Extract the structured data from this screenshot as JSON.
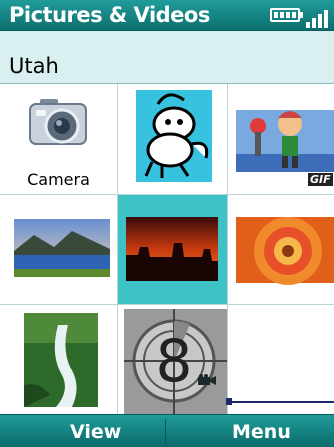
{
  "title_bar": {
    "title": "Pictures & Videos",
    "battery_icon": "battery-icon",
    "signal_icon": "signal-icon"
  },
  "folder": {
    "name": "Utah"
  },
  "items": [
    {
      "label": "Camera",
      "icon": "camera-icon"
    },
    {
      "label": "",
      "icon": "cartoon-character"
    },
    {
      "label": "",
      "icon": "cartoon-animation",
      "badge": "GIF"
    },
    {
      "label": "",
      "icon": "lake-landscape"
    },
    {
      "label": "",
      "icon": "desert-sunset",
      "selected": true
    },
    {
      "label": "",
      "icon": "flower-closeup"
    },
    {
      "label": "",
      "icon": "waterfall"
    },
    {
      "label": "",
      "icon": "film-countdown",
      "badge": "video-camera-icon"
    },
    {
      "label": "",
      "icon": "empty"
    }
  ],
  "countdown_number": "8",
  "softkeys": {
    "left": "View",
    "right": "Menu"
  },
  "colors": {
    "accent": "#158685",
    "selection": "#3cc1c5",
    "folder_bg": "#d9eff0"
  }
}
